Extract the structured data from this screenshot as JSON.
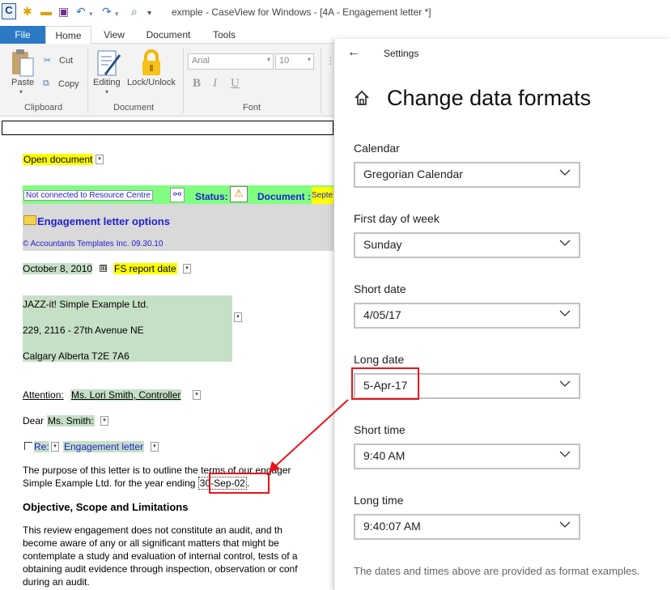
{
  "window": {
    "title": "exmple - CaseView for Windows - [4A - Engagement letter *]",
    "app_icon_letter": "C"
  },
  "ribbon": {
    "tabs": [
      "File",
      "Home",
      "View",
      "Document",
      "Tools"
    ],
    "paste_label": "Paste",
    "cut_label": "Cut",
    "copy_label": "Copy",
    "clipboard_group": "Clipboard",
    "editing_label": "Editing",
    "lock_label": "Lock/Unlock",
    "document_group": "Document",
    "font_name": "Arial",
    "font_size": "10",
    "bold": "B",
    "italic": "I",
    "underline": "U",
    "font_group": "Font"
  },
  "document": {
    "open_document": "Open document",
    "not_connected": "Not connected to Resource Centre",
    "status_label": "Status:",
    "document_label": "Document :",
    "document_value": "Septe",
    "options_title": "Engagement letter options",
    "copyright": "© Accountants Templates Inc. 09.30.10",
    "date": "October 8, 2010",
    "fs_report_date": "FS report date",
    "address": [
      "JAZZ-it! Simple Example Ltd.",
      "229, 2116 - 27th Avenue NE",
      "Calgary Alberta  T2E 7A6"
    ],
    "attention_label": "Attention:",
    "attention_value": "Ms. Lori Smith, Controller",
    "dear_label": "Dear",
    "dear_value": "Ms. Smith:",
    "re_label": "Re:",
    "re_value": "Engagement letter",
    "para1_line1": "The  purpose  of  this  letter  is  to  outline  the  terms  of  our  engager",
    "para1_line2_pre": "Simple Example Ltd. for the year ending ",
    "para1_date": "30-Sep-02",
    "para1_line2_post": ".",
    "heading": "Objective, Scope and Limitations",
    "para2": [
      "This  review  engagement  does  not  constitute  an  audit,  and  th",
      "become  aware  of  any  or  all  significant  matters  that  might  be",
      "contemplate  a  study  and  evaluation  of  internal  control,  tests  of  a",
      "obtaining  audit  evidence  through  inspection,  observation  or  conf",
      "during an audit."
    ]
  },
  "settings": {
    "header": "Settings",
    "title": "Change data formats",
    "fields": [
      {
        "label": "Calendar",
        "value": "Gregorian Calendar"
      },
      {
        "label": "First day of week",
        "value": "Sunday"
      },
      {
        "label": "Short date",
        "value": "4/05/17"
      },
      {
        "label": "Long date",
        "value": "5-Apr-17"
      },
      {
        "label": "Short time",
        "value": "9:40 AM"
      },
      {
        "label": "Long time",
        "value": "9:40:07 AM"
      }
    ],
    "footnote": "The dates and times above are provided as format examples."
  },
  "colors": {
    "highlight_red": "#e8141c",
    "file_tab_blue": "#2b79c5",
    "field_yellow": "#ffff00",
    "field_green": "#c6e0c6",
    "banner_green": "#80ff80",
    "link_blue": "#1f1fd0"
  }
}
